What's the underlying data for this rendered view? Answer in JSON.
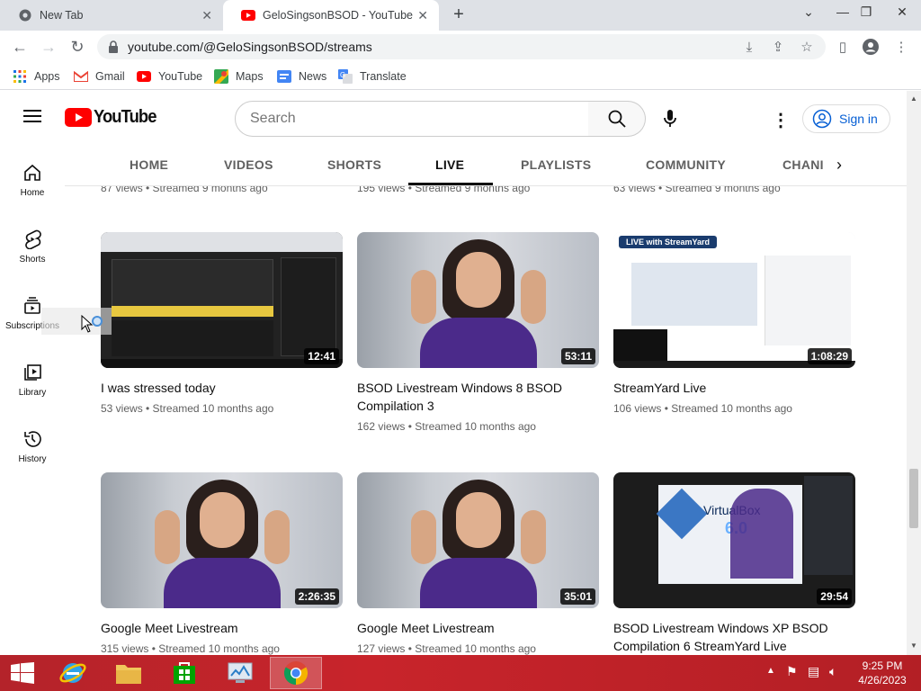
{
  "browser": {
    "tabs": [
      {
        "label": "New Tab"
      },
      {
        "label": "GeloSingsonBSOD - YouTube"
      }
    ],
    "url": "youtube.com/@GeloSingsonBSOD/streams"
  },
  "bookmarks": [
    {
      "label": "Apps"
    },
    {
      "label": "Gmail"
    },
    {
      "label": "YouTube"
    },
    {
      "label": "Maps"
    },
    {
      "label": "News"
    },
    {
      "label": "Translate"
    }
  ],
  "youtube": {
    "logo_text": "YouTube",
    "search_placeholder": "Search",
    "signin_label": "Sign in",
    "channel_tabs": [
      {
        "label": "HOME"
      },
      {
        "label": "VIDEOS"
      },
      {
        "label": "SHORTS"
      },
      {
        "label": "LIVE"
      },
      {
        "label": "PLAYLISTS"
      },
      {
        "label": "COMMUNITY"
      },
      {
        "label": "CHANI"
      }
    ],
    "active_tab": "LIVE",
    "guide": [
      {
        "label": "Home"
      },
      {
        "label": "Shorts"
      },
      {
        "label": "Subscriptions"
      },
      {
        "label": "Library"
      },
      {
        "label": "History"
      }
    ],
    "partial_meta_top": [
      "87 views • Streamed 9 months ago",
      "195 views • Streamed 9 months ago",
      "63 views • Streamed 9 months ago"
    ],
    "videos": [
      {
        "title": "I was stressed today",
        "duration": "12:41",
        "meta": "53 views • Streamed 10 months ago"
      },
      {
        "title": "BSOD Livestream Windows 8 BSOD Compilation 3",
        "duration": "53:11",
        "meta": "162 views • Streamed 10 months ago"
      },
      {
        "title": "StreamYard Live",
        "duration": "1:08:29",
        "meta": "106 views • Streamed 10 months ago"
      },
      {
        "title": "Google Meet Livestream",
        "duration": "2:26:35",
        "meta": "315 views • Streamed 10 months ago"
      },
      {
        "title": "Google Meet Livestream",
        "duration": "35:01",
        "meta": "127 views • Streamed 10 months ago"
      },
      {
        "title": "BSOD Livestream Windows XP BSOD Compilation 6 StreamYard Live",
        "duration": "29:54",
        "meta": ""
      }
    ],
    "thumb_overlays": {
      "streamyard_badge": "LIVE with StreamYard",
      "virtualbox_text": "VirtualBox",
      "virtualbox_version": "6.0"
    }
  },
  "taskbar": {
    "time": "9:25 PM",
    "date": "4/26/2023"
  },
  "colors": {
    "youtube_red": "#ff0000",
    "link_blue": "#065fd4",
    "taskbar_red": "#c8242b"
  }
}
